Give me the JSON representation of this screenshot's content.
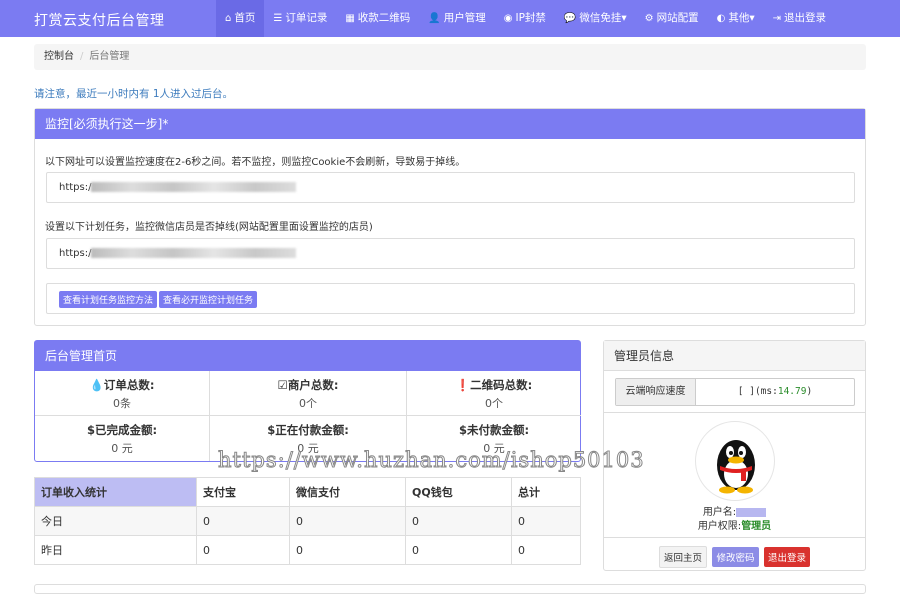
{
  "brand": "打赏云支付后台管理",
  "nav": [
    {
      "icon": "⌂",
      "icon_name": "home-icon",
      "label": "首页",
      "active": true
    },
    {
      "icon": "☰",
      "icon_name": "list-icon",
      "label": "订单记录"
    },
    {
      "icon": "▦",
      "icon_name": "qrcode-icon",
      "label": "收款二维码"
    },
    {
      "icon": "👤",
      "icon_name": "user-icon",
      "label": "用户管理"
    },
    {
      "icon": "◉",
      "icon_name": "globe-icon",
      "label": "IP封禁"
    },
    {
      "icon": "💬",
      "icon_name": "wechat-icon",
      "label": "微信免挂",
      "caret": true
    },
    {
      "icon": "⚙",
      "icon_name": "gear-icon",
      "label": "网站配置"
    },
    {
      "icon": "◐",
      "icon_name": "more-icon",
      "label": "其他",
      "caret": true
    },
    {
      "icon": "⇥",
      "icon_name": "logout-icon",
      "label": "退出登录"
    }
  ],
  "breadcrumb": {
    "home": "控制台",
    "current": "后台管理"
  },
  "notice": "请注意，最近一小时内有 1人进入过后台。",
  "monitor": {
    "title": "监控[必须执行这一步]*",
    "text1": "以下网址可以设置监控速度在2-6秒之间。若不监控，则监控Cookie不会刷新，导致易于掉线。",
    "url1_prefix": "https:/",
    "text2": "设置以下计划任务，监控微信店员是否掉线(网站配置里面设置监控的店员)",
    "url2_prefix": "https:/",
    "btn1": "查看计划任务监控方法",
    "btn2": "查看必开监控计划任务"
  },
  "home_panel": {
    "title": "后台管理首页",
    "stats": [
      {
        "icon": "💧",
        "icon_name": "drop-icon",
        "label": "订单总数:",
        "value": "0条"
      },
      {
        "icon": "☑",
        "icon_name": "check-icon",
        "label": "商户总数:",
        "value": "0个"
      },
      {
        "icon": "❗",
        "icon_name": "alert-icon",
        "label": "二维码总数:",
        "value": "0个"
      },
      {
        "icon": "$",
        "icon_name": "dollar-icon",
        "label": "已完成金额:",
        "value": "0 元"
      },
      {
        "icon": "$",
        "icon_name": "dollar-icon",
        "label": "正在付款金额:",
        "value": "0 元"
      },
      {
        "icon": "$",
        "icon_name": "dollar-icon",
        "label": "未付款金额:",
        "value": "0 元"
      }
    ]
  },
  "income_table": {
    "headers": [
      "订单收入统计",
      "支付宝",
      "微信支付",
      "QQ钱包",
      "总计"
    ],
    "rows": [
      [
        "今日",
        "0",
        "0",
        "0",
        "0"
      ],
      [
        "昨日",
        "0",
        "0",
        "0",
        "0"
      ]
    ]
  },
  "admin": {
    "title": "管理员信息",
    "speed_label": "云端响应速度",
    "speed_open": "[ ](ms:",
    "speed_value": "14.79",
    "speed_close": ")",
    "username_label": "用户名:",
    "role_label": "用户权限:",
    "role_value": "管理员",
    "btn_home": "返回主页",
    "btn_pwd": "修改密码",
    "btn_logout": "退出登录"
  },
  "watermark": "https://www.huzhan.com/ishop50103",
  "colors": {
    "accent": "#7b7bf2",
    "success": "#2a8c2a",
    "danger": "#d9322e",
    "link": "#3c7bbd"
  }
}
